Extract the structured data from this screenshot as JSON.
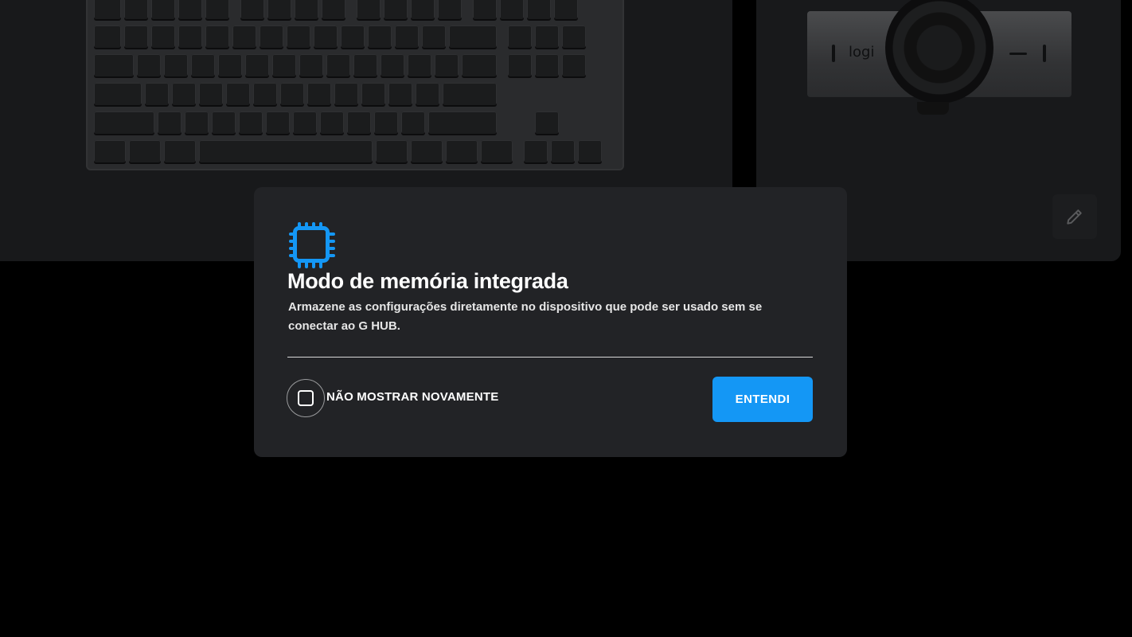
{
  "background": {
    "webcam_brand": "logi"
  },
  "modal": {
    "icon": "chip-icon",
    "title": "Modo de memória integrada",
    "description": "Armazene as configurações diretamente no dispositivo que pode ser usado sem se conectar ao G HUB.",
    "checkbox": {
      "label": "NÃO MOSTRAR NOVAMENTE",
      "checked": false
    },
    "confirm_button": "ENTENDI"
  },
  "colors": {
    "accent": "#1497f5",
    "modal_bg": "#222326",
    "page_bg": "#000000"
  }
}
